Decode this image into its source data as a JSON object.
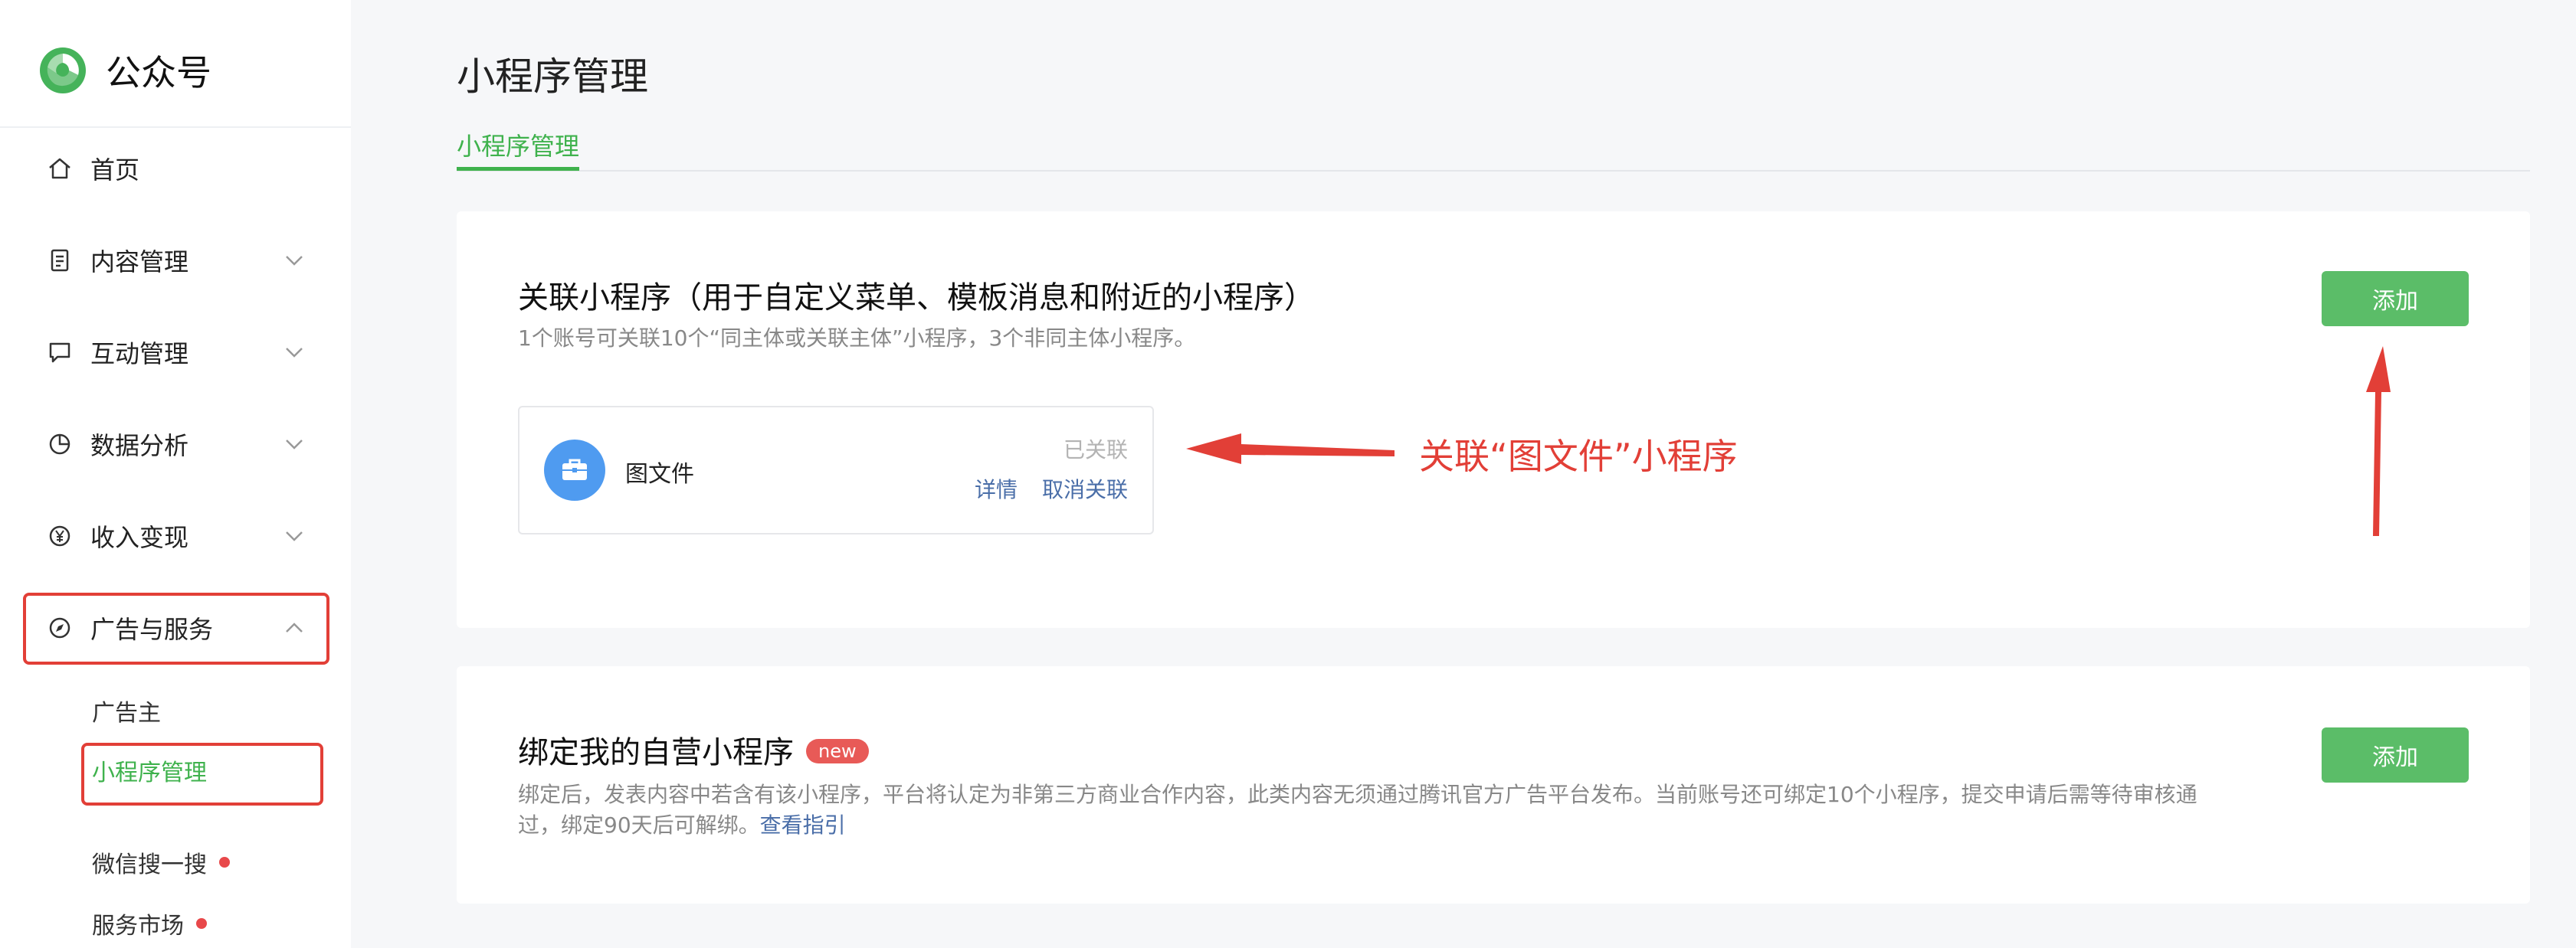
{
  "brand": {
    "name": "公众号"
  },
  "sidebar": {
    "items": [
      {
        "label": "首页",
        "icon": "home-icon",
        "chevron": false
      },
      {
        "label": "内容管理",
        "icon": "document-icon",
        "chevron": true
      },
      {
        "label": "互动管理",
        "icon": "chat-icon",
        "chevron": true
      },
      {
        "label": "数据分析",
        "icon": "pie-chart-icon",
        "chevron": true
      },
      {
        "label": "收入变现",
        "icon": "yen-icon",
        "chevron": true
      },
      {
        "label": "广告与服务",
        "icon": "compass-icon",
        "chevron": true,
        "expanded": true
      }
    ],
    "subitems": [
      {
        "label": "广告主",
        "active": false,
        "dot": false
      },
      {
        "label": "小程序管理",
        "active": true,
        "dot": false
      },
      {
        "label": "微信搜一搜",
        "active": false,
        "dot": true
      },
      {
        "label": "服务市场",
        "active": false,
        "dot": true
      }
    ]
  },
  "page": {
    "title": "小程序管理",
    "tab": "小程序管理"
  },
  "card1": {
    "title": "关联小程序（用于自定义菜单、模板消息和附近的小程序）",
    "desc": "1个账号可关联10个“同主体或关联主体”小程序，3个非同主体小程序。",
    "add_label": "添加",
    "mini_program": {
      "name": "图文件",
      "status": "已关联",
      "detail_label": "详情",
      "unlink_label": "取消关联",
      "icon": "briefcase-icon"
    }
  },
  "card2": {
    "title": "绑定我的自营小程序",
    "badge": "new",
    "desc_line1": "绑定后，发表内容中若含有该小程序，平台将认定为非第三方商业合作内容，此类内容无须通过腾讯官方广告平台发布。当前账号还可绑定10个小程序，提交申请后需等待审核通",
    "desc_line2": "过，绑定90天后可解绑。",
    "guide_link": "查看指引",
    "add_label": "添加"
  },
  "annotation": {
    "text": "关联“图文件”小程序",
    "color": "#e23f37"
  },
  "colors": {
    "accent": "#3fb24d",
    "button": "#5bbd68",
    "highlight": "#e23f37",
    "link": "#4a6ea8",
    "avatar": "#4f9bf0"
  }
}
